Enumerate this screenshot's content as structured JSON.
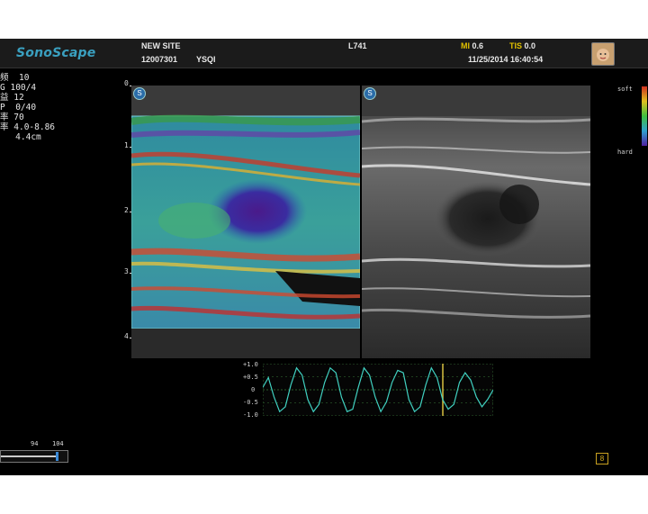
{
  "header": {
    "logo": "SonoScape",
    "site": "NEW SITE",
    "patient_id": "12007301",
    "operator": "YSQI",
    "probe": "L741",
    "mi_label": "MI",
    "mi_value": "0.6",
    "tis_label": "TIS",
    "tis_value": "0.0",
    "datetime": "11/25/2014 16:40:54"
  },
  "params": [
    {
      "label": "频",
      "value": "10"
    },
    {
      "label": "G",
      "value": "100/4"
    },
    {
      "label": "益",
      "value": "12"
    },
    {
      "label": "P",
      "value": "0/40"
    },
    {
      "label": "率",
      "value": "70"
    },
    {
      "label": "率",
      "value": "4.0-8.86"
    },
    {
      "label": "",
      "value": "4.4cm"
    }
  ],
  "depth_scale": [
    "0",
    "1",
    "2",
    "3",
    "4"
  ],
  "elasto_scale": {
    "top": "soft",
    "bottom": "hard"
  },
  "strain_graph": {
    "labels": [
      "+1.0",
      "+0.5",
      "0",
      "-0.5",
      "-1.0"
    ],
    "values": [
      0.1,
      0.5,
      -0.3,
      -0.9,
      -0.7,
      0.2,
      0.9,
      0.6,
      -0.4,
      -0.9,
      -0.6,
      0.3,
      0.9,
      0.7,
      -0.3,
      -0.9,
      -0.8,
      0.1,
      0.9,
      0.6,
      -0.3,
      -0.9,
      -0.5,
      0.3,
      0.8,
      0.7,
      -0.4,
      -0.9,
      -0.7,
      0.2,
      0.9,
      0.5,
      -0.4,
      -0.8,
      -0.6,
      0.3,
      0.7,
      0.4,
      -0.3,
      -0.7,
      -0.4,
      0.0
    ]
  },
  "slider": {
    "left_label": "94",
    "right_label": "104"
  },
  "badge": "8",
  "colors": {
    "logo": "#3aa0c0",
    "accent_yellow": "#e0c000",
    "trace": "#40d0c0"
  }
}
